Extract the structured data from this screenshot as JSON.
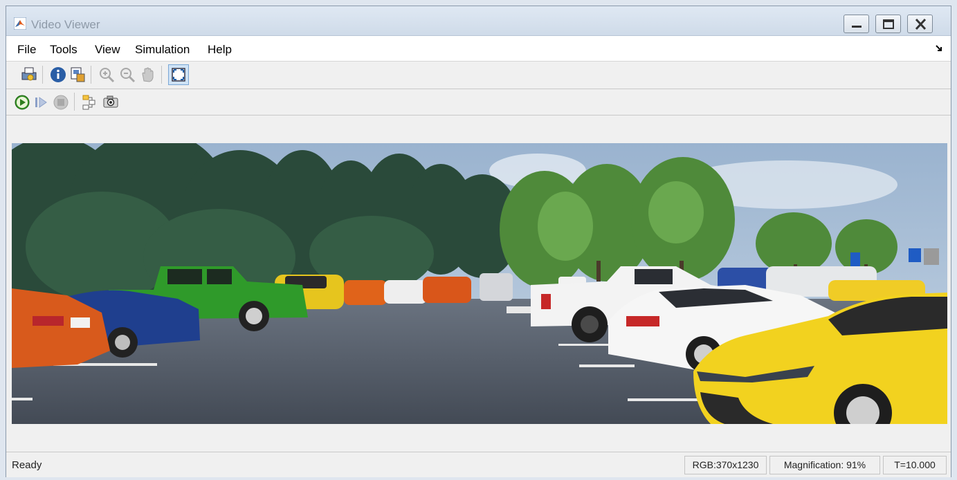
{
  "window": {
    "title": "Video Viewer",
    "controls": {
      "minimize": "minimize-icon",
      "maximize": "maximize-icon",
      "close": "close-icon"
    }
  },
  "menu": {
    "items": [
      "File",
      "Tools",
      "View",
      "Simulation",
      "Help"
    ]
  },
  "toolbar1": {
    "buttons": [
      "print-icon",
      "info-icon",
      "video-info-icon",
      "zoom-in-icon",
      "zoom-out-icon",
      "pan-hand-icon",
      "fit-to-window-icon"
    ]
  },
  "toolbar2": {
    "buttons": [
      "run-icon",
      "step-forward-icon",
      "stop-icon",
      "highlight-block-icon",
      "snapshot-icon"
    ]
  },
  "status": {
    "message": "Ready",
    "rgb": "RGB:370x1230",
    "magnification": "Magnification: 91%",
    "time": "T=10.000"
  },
  "colors": {
    "titlebar": "#cfdbe9",
    "window_bg": "#f0f0f0",
    "sky": "#9fb6cf",
    "asphalt": "#4f5763"
  }
}
